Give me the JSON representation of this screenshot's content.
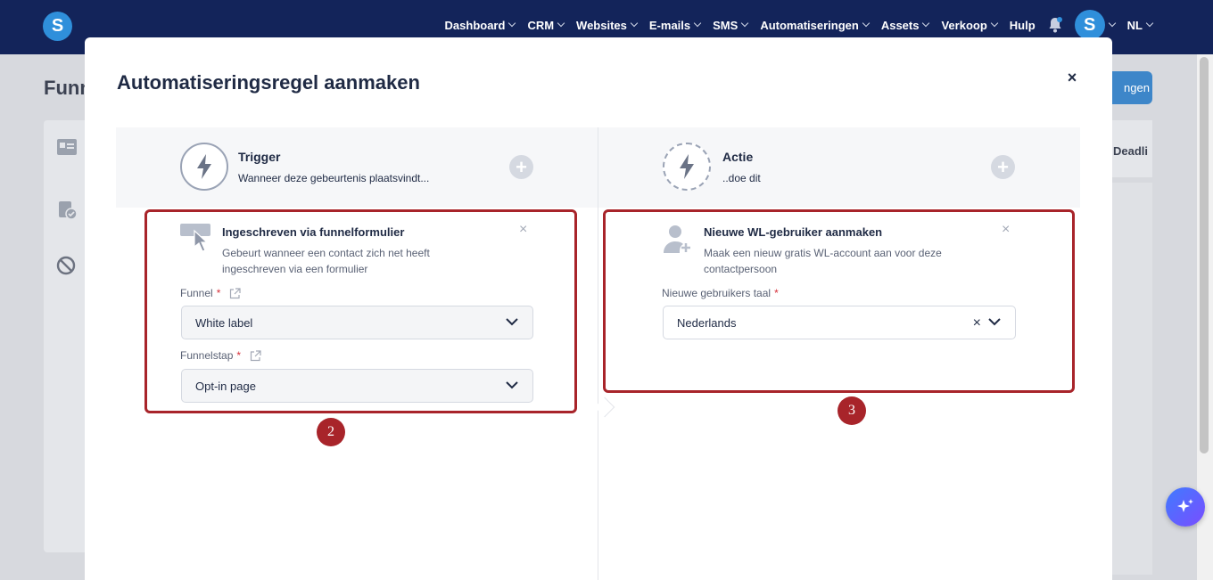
{
  "nav": {
    "logo": "S",
    "items": [
      {
        "label": "Dashboard"
      },
      {
        "label": "CRM"
      },
      {
        "label": "Websites"
      },
      {
        "label": "E-mails"
      },
      {
        "label": "SMS"
      },
      {
        "label": "Automatiseringen"
      },
      {
        "label": "Assets"
      },
      {
        "label": "Verkoop"
      }
    ],
    "help": "Hulp",
    "avatar": "S",
    "language": "NL"
  },
  "background": {
    "title": "Funn",
    "button": "ngen",
    "column_label": "Deadli"
  },
  "modal": {
    "title": "Automatiseringsregel aanmaken",
    "close": "×",
    "trigger": {
      "title": "Trigger",
      "subtitle": "Wanneer deze gebeurtenis plaatsvindt...",
      "card": {
        "title": "Ingeschreven via funnelformulier",
        "description_line1": "Gebeurt wanneer een contact zich net heeft",
        "description_line2": "ingeschreven via een formulier",
        "close": "×",
        "fields": [
          {
            "label": "Funnel",
            "required": "*",
            "value": "White label"
          },
          {
            "label": "Funnelstap",
            "required": "*",
            "value": "Opt-in page"
          }
        ],
        "badge": "2"
      }
    },
    "action": {
      "title": "Actie",
      "subtitle": "..doe dit",
      "card": {
        "title": "Nieuwe WL-gebruiker aanmaken",
        "description_line1": "Maak een nieuw gratis WL-account aan voor deze",
        "description_line2": "contactpersoon",
        "close": "×",
        "field": {
          "label": "Nieuwe gebruikers taal",
          "required": "*",
          "value": "Nederlands",
          "clear": "×"
        },
        "badge": "3"
      }
    }
  },
  "colors": {
    "nav_bg": "#13245a",
    "brand_blue": "#2f8fdb",
    "highlight_red": "#a8242a"
  }
}
